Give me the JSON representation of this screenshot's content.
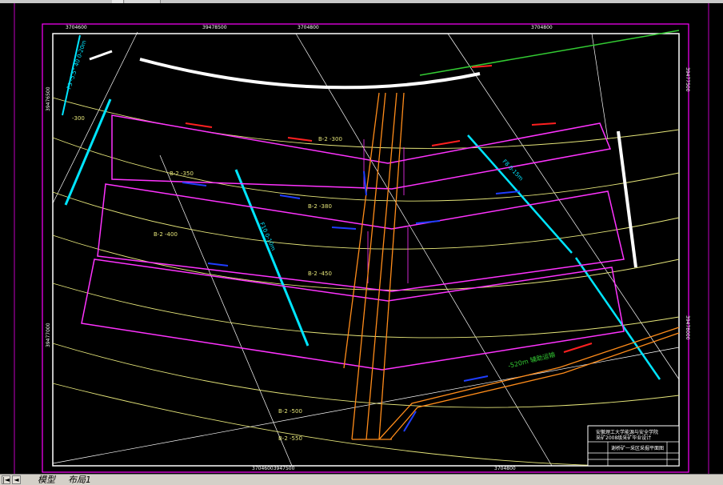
{
  "drawing": {
    "top_coords": [
      "3704600",
      "39478500",
      "3704800",
      "3704800"
    ],
    "bottom_coords": [
      "37046003947500",
      "3704800"
    ],
    "left_coords": [
      "39476500",
      "39477000"
    ],
    "right_coords": [
      "39477500",
      "39478000"
    ],
    "levels": [
      "B-2 -300",
      "B-2 -350",
      "B-2 -380",
      "B-2 -400",
      "B-2 -450",
      "B-2 -500",
      "B-2 -550",
      "-300"
    ],
    "fault_labels": [
      "F3  -5.5°  40  0-20m",
      "F10  0-10m",
      "F8  0-15m"
    ],
    "roadway_label": "-520m 辅助运输",
    "title_block": {
      "org_line1": "安徽理工大学能源与安全学院",
      "org_line2": "采矿2008级采矿毕业设计",
      "drawing_name": "谢桥矿一采区采掘平面图"
    }
  },
  "statusbar": {
    "nav_first": "|◄",
    "nav_prev": "◄",
    "tab_model": "模型",
    "tab_layout": "布局1"
  },
  "colors": {
    "frame": "#ffffff",
    "viewport_border": "#ff00ff",
    "panels": "#ff33ff",
    "contours": "#e6e67a",
    "faults": "#00e5ff",
    "roadways": "#ff8c1a",
    "red_arrows": "#ff2020",
    "blue_arrows": "#1f3dff",
    "green_line": "#33cc33"
  }
}
